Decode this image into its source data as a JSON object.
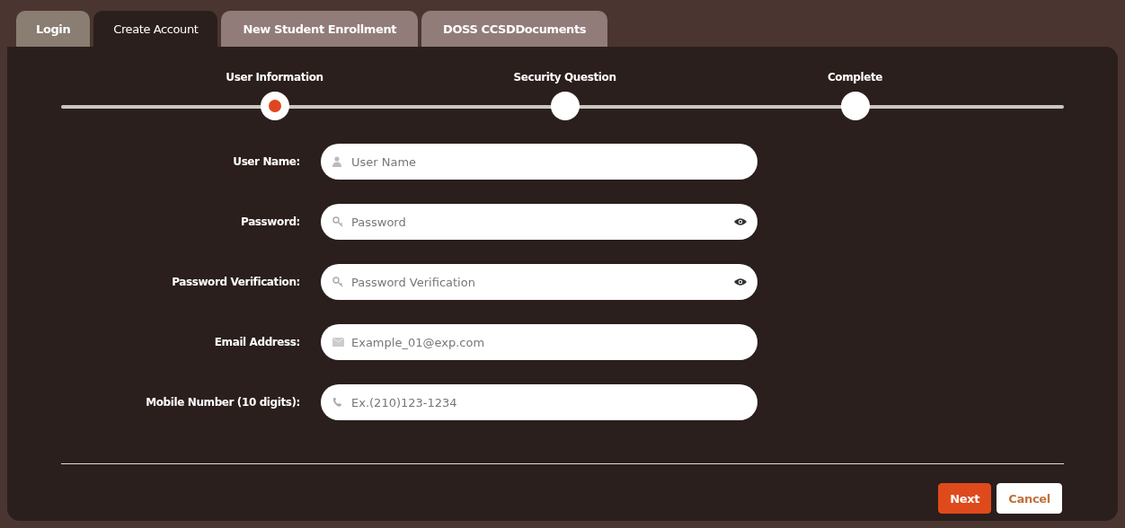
{
  "tabs": [
    {
      "label": "Login",
      "selected": false
    },
    {
      "label": "Create Account",
      "selected": true
    },
    {
      "label": "New Student Enrollment",
      "selected": false
    },
    {
      "label": "DOSS CCSDDocuments",
      "selected": false
    }
  ],
  "steps": [
    {
      "label": "User Information",
      "selected": true
    },
    {
      "label": "Security Question",
      "selected": false
    },
    {
      "label": "Complete",
      "selected": false
    }
  ],
  "fields": [
    {
      "label": "User Name:",
      "placeholder": "User Name",
      "kind": "user",
      "reveal": false
    },
    {
      "label": "Password:",
      "placeholder": "Password",
      "kind": "key",
      "reveal": true
    },
    {
      "label": "Password Verification:",
      "placeholder": "Password Verification",
      "kind": "key",
      "reveal": true
    },
    {
      "label": "Email Address:",
      "placeholder": "Example_01@exp.com",
      "kind": "email",
      "reveal": false
    },
    {
      "label": "Mobile Number (10 digits):",
      "placeholder": "Ex.(210)123-1234",
      "kind": "phone",
      "reveal": false
    }
  ],
  "buttons": [
    {
      "label": "Next",
      "kind": "primary"
    },
    {
      "label": "Cancel",
      "kind": "secondary"
    }
  ]
}
